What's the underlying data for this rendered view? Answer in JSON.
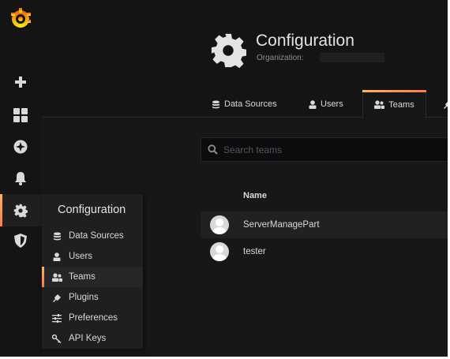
{
  "colors": {
    "background": "#161719",
    "sidemenu": "#141414",
    "accent_gradient": [
      "#ffb357",
      "#ff7941"
    ],
    "text": "#d8d9da"
  },
  "sidemenu": {
    "logo_icon": "grafana-logo-icon",
    "items": [
      {
        "icon": "plus-icon",
        "name": "create"
      },
      {
        "icon": "dashboards-grid-icon",
        "name": "dashboards"
      },
      {
        "icon": "compass-icon",
        "name": "explore"
      },
      {
        "icon": "bell-icon",
        "name": "alerting"
      },
      {
        "icon": "gear-icon",
        "name": "configuration",
        "active": true
      },
      {
        "icon": "shield-icon",
        "name": "server-admin"
      }
    ]
  },
  "dropdown": {
    "title": "Configuration",
    "items": [
      {
        "label": "Data Sources",
        "icon": "database-icon"
      },
      {
        "label": "Users",
        "icon": "user-icon"
      },
      {
        "label": "Teams",
        "icon": "users-icon",
        "active": true
      },
      {
        "label": "Plugins",
        "icon": "plug-icon"
      },
      {
        "label": "Preferences",
        "icon": "sliders-icon"
      },
      {
        "label": "API Keys",
        "icon": "key-icon"
      }
    ]
  },
  "header": {
    "title": "Configuration",
    "subtitle": "Organization:",
    "icon": "gear-icon"
  },
  "tabs": [
    {
      "label": "Data Sources",
      "icon": "database-icon"
    },
    {
      "label": "Users",
      "icon": "user-icon"
    },
    {
      "label": "Teams",
      "icon": "users-icon",
      "active": true
    },
    {
      "label": "",
      "icon": "plug-icon"
    }
  ],
  "search": {
    "placeholder": "Search teams",
    "value": ""
  },
  "table": {
    "columns": [
      "",
      "Name"
    ],
    "rows": [
      {
        "name": "ServerManagePart"
      },
      {
        "name": "tester"
      }
    ]
  }
}
